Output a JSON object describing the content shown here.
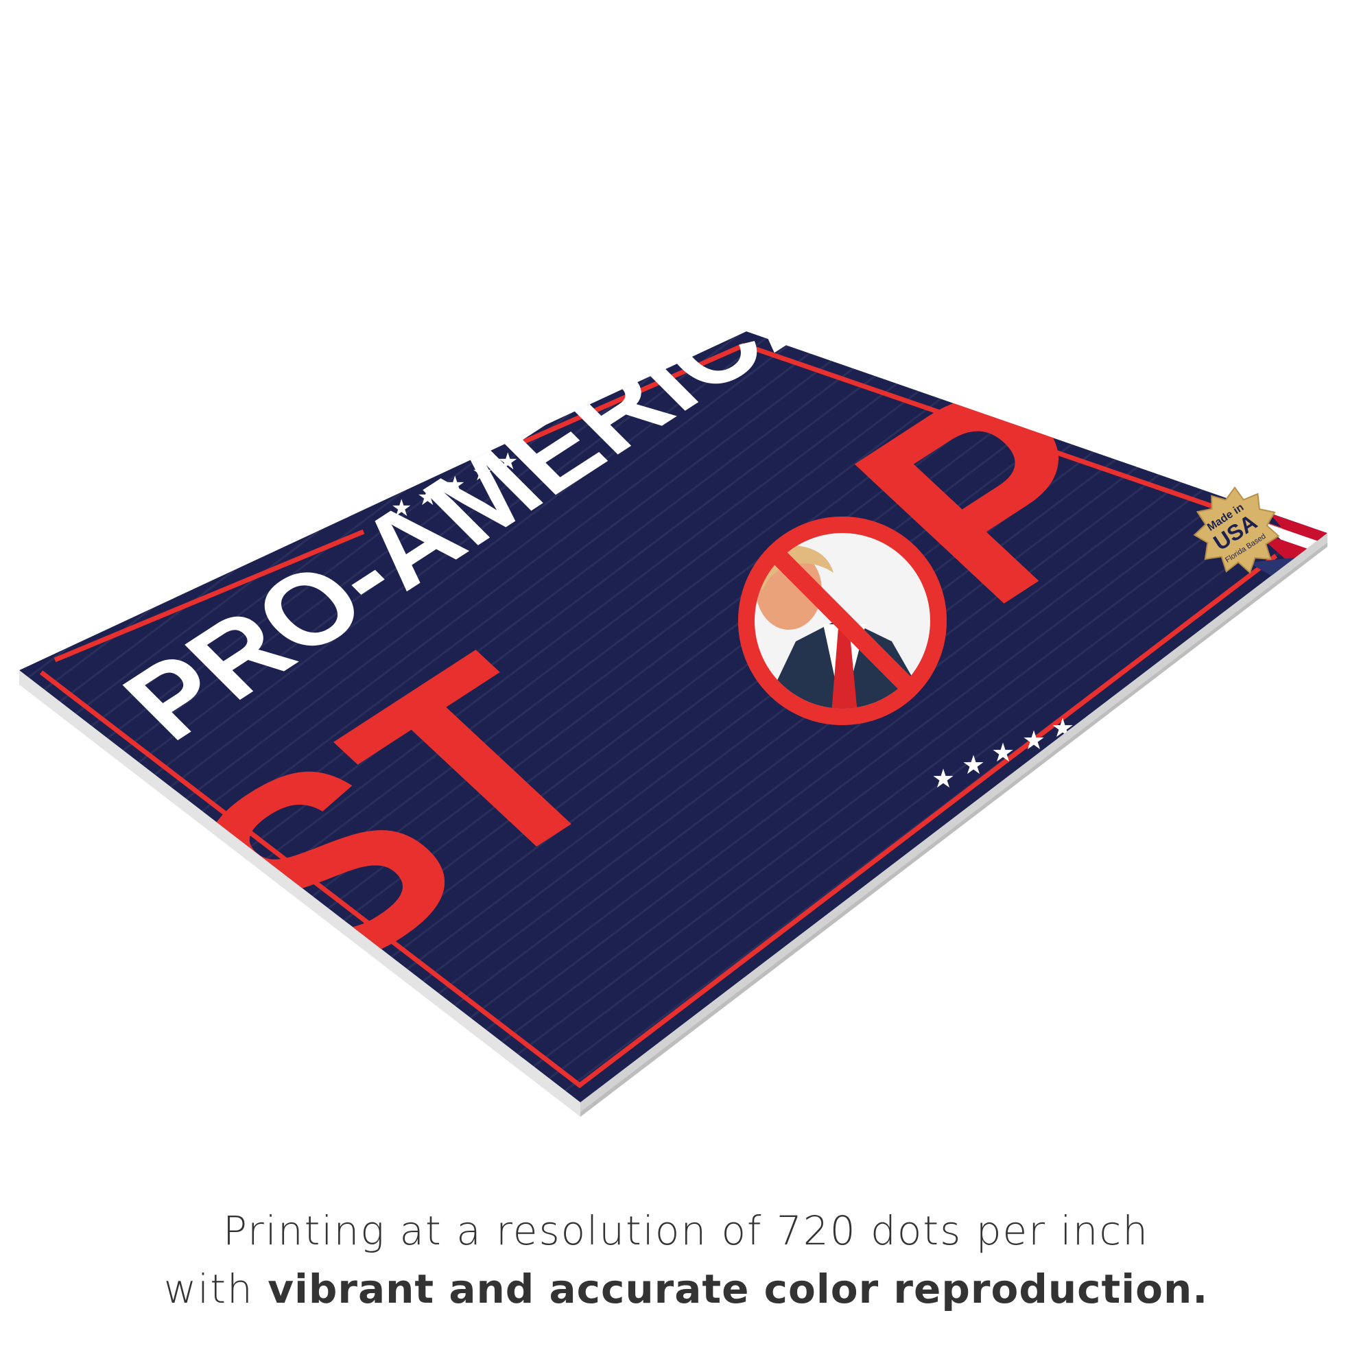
{
  "sign": {
    "headline": "PRO-AMERICA",
    "word_left": "ST",
    "word_right": "P",
    "badge": {
      "line1": "Made in",
      "line2": "USA",
      "line3": "Florida Based"
    },
    "colors": {
      "navy": "#1d2150",
      "red": "#e8302e",
      "white": "#ffffff",
      "gold": "#d8b46a"
    }
  },
  "caption": {
    "line1": "Printing at a resolution of 720 dots per inch",
    "line2_prefix": "with ",
    "line2_bold": "vibrant and accurate color reproduction."
  }
}
